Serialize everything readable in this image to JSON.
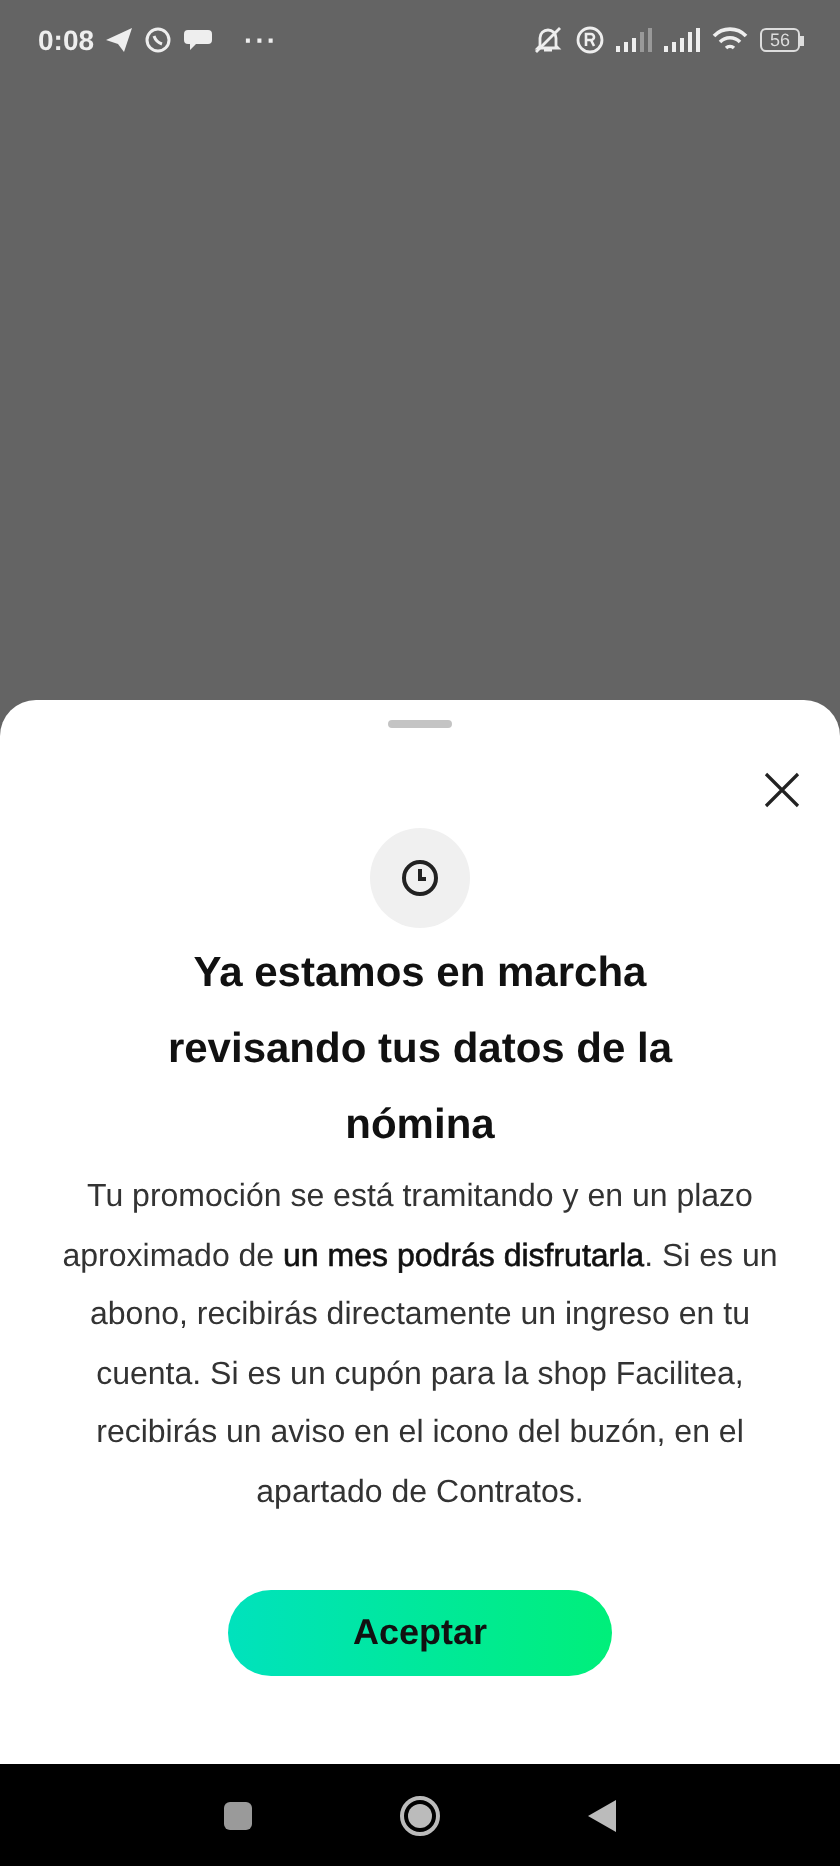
{
  "status_bar": {
    "time": "0:08",
    "more": "···",
    "battery": "56"
  },
  "sheet": {
    "title": "Ya estamos en marcha revisando tus datos de la nómina",
    "body": "Tu promoción se está tramitando y en un plazo aproximado de **un mes podrás disfrutarla**. Si es un abono, recibirás directamente un ingreso en tu cuenta. Si es un cupón para la shop Facilitea, recibirás un aviso en el icono del buzón, en el apartado de Contratos.",
    "button": "Aceptar"
  }
}
